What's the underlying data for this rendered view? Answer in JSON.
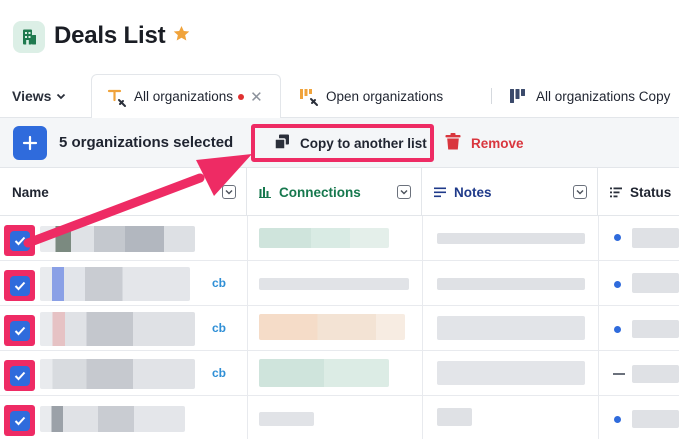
{
  "header": {
    "title": "Deals List",
    "app_icon": "building-icon",
    "star_icon": "star-icon",
    "star_color": "#f0a33b"
  },
  "tabs": {
    "views_label": "Views",
    "items": [
      {
        "label": "All organizations",
        "active": true,
        "unsaved": true
      },
      {
        "label": "Open organizations",
        "active": false
      },
      {
        "label": "All organizations Copy",
        "active": false
      }
    ]
  },
  "toolbar": {
    "selected_text": "5 organizations selected",
    "copy_label": "Copy to another list",
    "remove_label": "Remove",
    "accent": "#2f6bdc",
    "highlight": "#ee2b64",
    "danger": "#d9363e"
  },
  "table": {
    "columns": [
      {
        "label": "Name"
      },
      {
        "label": "Connections",
        "color": "#17784e"
      },
      {
        "label": "Notes",
        "color": "#1f3a8a"
      },
      {
        "label": "Status"
      }
    ],
    "rows": [
      {
        "checked": true,
        "tag": "",
        "status": "dot"
      },
      {
        "checked": true,
        "tag": "cb",
        "status": "dot"
      },
      {
        "checked": true,
        "tag": "cb",
        "status": "dot"
      },
      {
        "checked": true,
        "tag": "cb",
        "status": "dash"
      },
      {
        "checked": true,
        "tag": "",
        "status": "dot"
      }
    ]
  }
}
